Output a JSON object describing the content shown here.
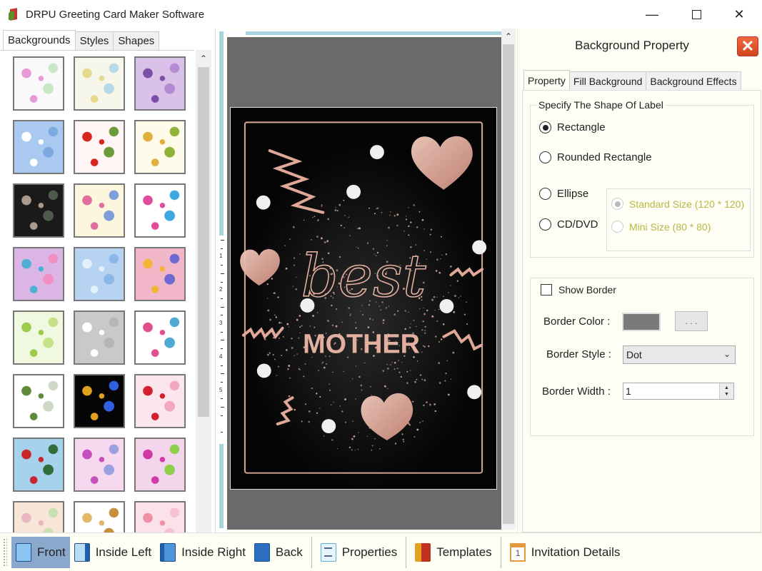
{
  "window": {
    "title": "DRPU Greeting Card Maker Software",
    "controls": {
      "minimize": "—",
      "maximize": "",
      "close": "✕"
    }
  },
  "left_panel": {
    "tabs": [
      {
        "label": "Backgrounds",
        "active": true
      },
      {
        "label": "Styles",
        "active": false
      },
      {
        "label": "Shapes",
        "active": false
      }
    ],
    "scroll_up": "⌃",
    "thumbnails": [
      {
        "name": "pastel-doodles",
        "colors": [
          "#fbf8fb",
          "#e79ad6",
          "#c9e6c6"
        ]
      },
      {
        "name": "baby-items",
        "colors": [
          "#f6f7ea",
          "#e5d88f",
          "#b8d8e6"
        ]
      },
      {
        "name": "purple-flowers",
        "colors": [
          "#d9c1ea",
          "#7b4fa8",
          "#b48ad4"
        ]
      },
      {
        "name": "sky-clouds",
        "colors": [
          "#a9c9f0",
          "#ffffff",
          "#7ea9e0"
        ]
      },
      {
        "name": "strawberries",
        "colors": [
          "#fff5f5",
          "#d7261e",
          "#6b9b3a"
        ]
      },
      {
        "name": "autumn-leaves",
        "colors": [
          "#fffbea",
          "#e0b03a",
          "#8fb43a"
        ]
      },
      {
        "name": "dark-roses",
        "colors": [
          "#1a1a1a",
          "#a99a8c",
          "#4d5a4c"
        ]
      },
      {
        "name": "tiny-flowers",
        "colors": [
          "#fbf6dc",
          "#e06fa0",
          "#7d9ed9"
        ]
      },
      {
        "name": "gift-boxes",
        "colors": [
          "#ffffff",
          "#e04d9b",
          "#3ea9e0"
        ]
      },
      {
        "name": "pastel-blossoms",
        "colors": [
          "#dbb5e6",
          "#4fb0d4",
          "#f08fc0"
        ]
      },
      {
        "name": "snowflakes",
        "colors": [
          "#b6d4f2",
          "#e4f0fc",
          "#8bb8e8"
        ]
      },
      {
        "name": "colorful-circles",
        "colors": [
          "#f2b6c9",
          "#f0b53a",
          "#6c6ad0"
        ]
      },
      {
        "name": "green-trees",
        "colors": [
          "#f1f8e0",
          "#9cca4a",
          "#c7e189"
        ]
      },
      {
        "name": "white-heart",
        "colors": [
          "#c9c9c9",
          "#ffffff",
          "#b5b5b5"
        ]
      },
      {
        "name": "birthday-text",
        "colors": [
          "#ffffff",
          "#e0508f",
          "#4fa9d4"
        ]
      },
      {
        "name": "grapes-white",
        "colors": [
          "#ffffff",
          "#5e8a3a",
          "#cfd8c5"
        ]
      },
      {
        "name": "fireworks",
        "colors": [
          "#050505",
          "#e0a020",
          "#3060e0"
        ]
      },
      {
        "name": "red-hearts",
        "colors": [
          "#fbe6ee",
          "#d2202e",
          "#f2a6c0"
        ]
      },
      {
        "name": "santa-pattern",
        "colors": [
          "#a6d2ec",
          "#c8262a",
          "#2e6e3a"
        ]
      },
      {
        "name": "pink-pompoms",
        "colors": [
          "#f6d9ee",
          "#c84dbd",
          "#9aa0e0"
        ]
      },
      {
        "name": "pink-butterflies",
        "colors": [
          "#f4d6ec",
          "#d03aa8",
          "#8fd04a"
        ]
      },
      {
        "name": "pastel-stripes",
        "colors": [
          "#f7e6d8",
          "#e9b7c0",
          "#c7e1b0"
        ]
      },
      {
        "name": "teddy-bear",
        "colors": [
          "#ffffff",
          "#e2b86a",
          "#c58f3e"
        ]
      },
      {
        "name": "pink-dress",
        "colors": [
          "#fbe2ea",
          "#f08fa8",
          "#f6c2d0"
        ]
      }
    ]
  },
  "ruler": {
    "numbers": [
      "1",
      "2",
      "3",
      "4",
      "5"
    ]
  },
  "card": {
    "script_text": "best",
    "headline": "MOTHER",
    "accent_color": "#e3b09f",
    "background_color": "#050505"
  },
  "canvas_scroll_up": "⌃",
  "right_panel": {
    "title": "Background Property",
    "close_icon": "✕",
    "tabs": [
      {
        "label": "Property",
        "active": true
      },
      {
        "label": "Fill Background",
        "active": false
      },
      {
        "label": "Background Effects",
        "active": false
      }
    ],
    "shape_group": {
      "legend": "Specify The Shape Of Label",
      "options": [
        {
          "label": "Rectangle",
          "checked": true
        },
        {
          "label": "Rounded Rectangle",
          "checked": false
        },
        {
          "label": "Ellipse",
          "checked": false
        },
        {
          "label": "CD/DVD",
          "checked": false
        }
      ],
      "size_options": [
        {
          "label": "Standard Size (120 * 120)",
          "checked": true,
          "disabled": true
        },
        {
          "label": "Mini Size (80 * 80)",
          "checked": false,
          "disabled": true
        }
      ]
    },
    "border_group": {
      "show_border_label": "Show Border",
      "show_border_checked": false,
      "border_color_label": "Border Color :",
      "border_color_value": "#7a7a7a",
      "color_picker_label": ". . .",
      "border_style_label": "Border Style :",
      "border_style_value": "Dot",
      "border_width_label": "Border Width :",
      "border_width_value": "1"
    }
  },
  "toolbar": {
    "buttons": [
      {
        "label": "Front",
        "active": true
      },
      {
        "label": "Inside Left",
        "active": false
      },
      {
        "label": "Inside Right",
        "active": false
      },
      {
        "label": "Back",
        "active": false
      },
      {
        "label": "Properties",
        "active": false
      },
      {
        "label": "Templates",
        "active": false
      },
      {
        "label": "Invitation Details",
        "active": false
      }
    ]
  }
}
